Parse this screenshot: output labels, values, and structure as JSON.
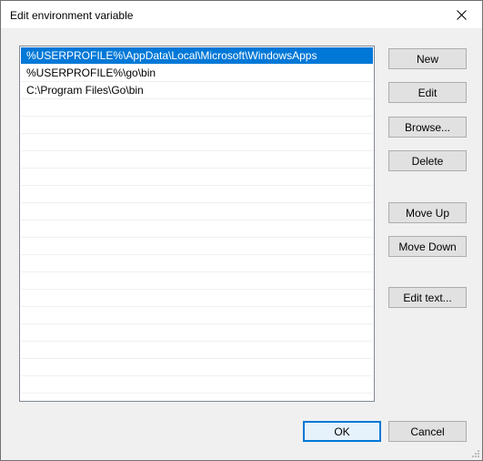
{
  "window": {
    "title": "Edit environment variable"
  },
  "list": {
    "items": [
      {
        "label": "%USERPROFILE%\\AppData\\Local\\Microsoft\\WindowsApps",
        "selected": true
      },
      {
        "label": "%USERPROFILE%\\go\\bin",
        "selected": false
      },
      {
        "label": "C:\\Program Files\\Go\\bin",
        "selected": false
      }
    ]
  },
  "buttons": {
    "new": "New",
    "edit": "Edit",
    "browse": "Browse...",
    "delete": "Delete",
    "move_up": "Move Up",
    "move_down": "Move Down",
    "edit_text": "Edit text...",
    "ok": "OK",
    "cancel": "Cancel"
  },
  "colors": {
    "selection": "#0078d7",
    "button_face": "#e1e1e1",
    "dialog_bg": "#f0f0f0"
  },
  "icons": {
    "close": "close-icon"
  }
}
